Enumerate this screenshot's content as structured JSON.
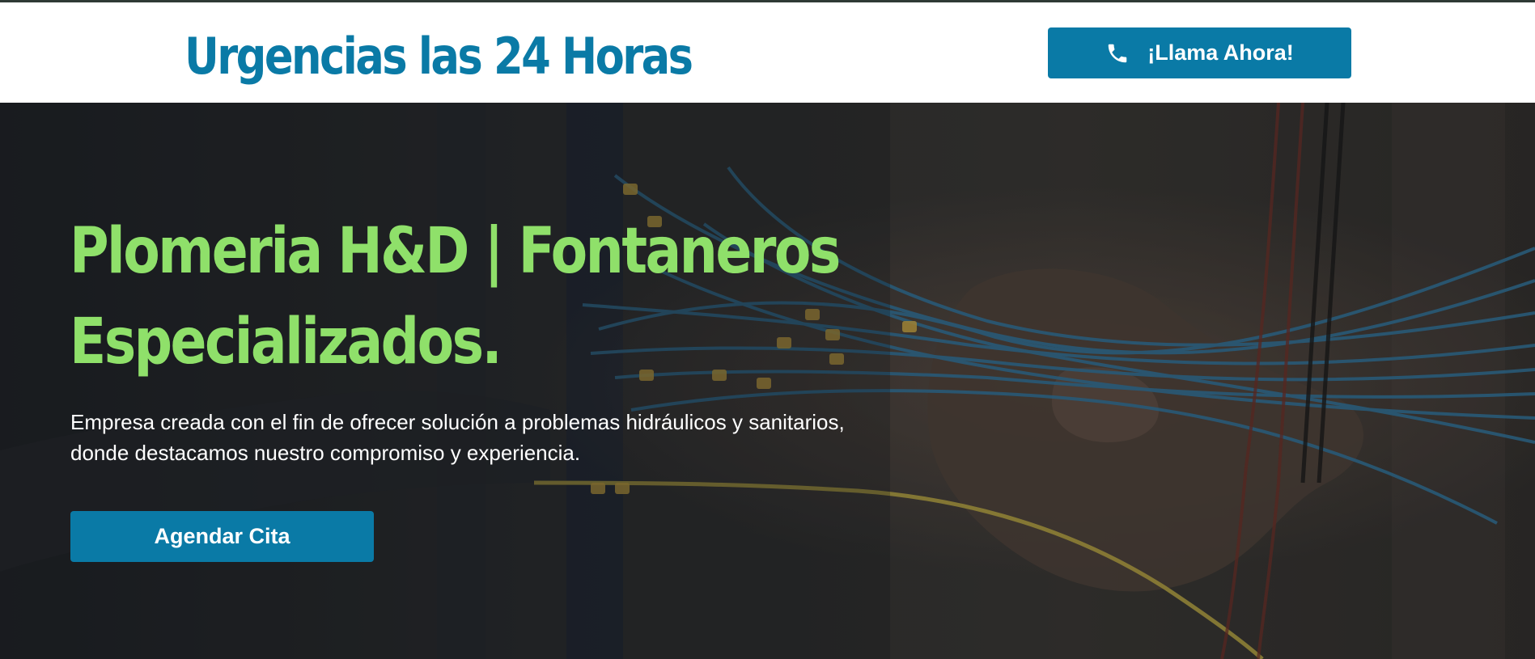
{
  "header": {
    "title": "Urgencias las 24 Horas",
    "call_button": {
      "icon": "phone-icon",
      "label": "¡Llama Ahora!"
    }
  },
  "hero": {
    "background": "dark photo of a hand holding a bundle of blue and yellow wires",
    "title_line1": "Plomeria H&D | Fontaneros",
    "title_line2": "Especializados.",
    "description": "Empresa creada con el fin de ofrecer solución a problemas hidráulicos y sanitarios, donde destacamos nuestro compromiso y experiencia.",
    "cta_label": "Agendar Cita"
  },
  "colors": {
    "brand_blue": "#0a7aa6",
    "accent_green": "#8fe06a",
    "hero_overlay": "#1c1c1c",
    "top_strip": "#2f3a35"
  }
}
